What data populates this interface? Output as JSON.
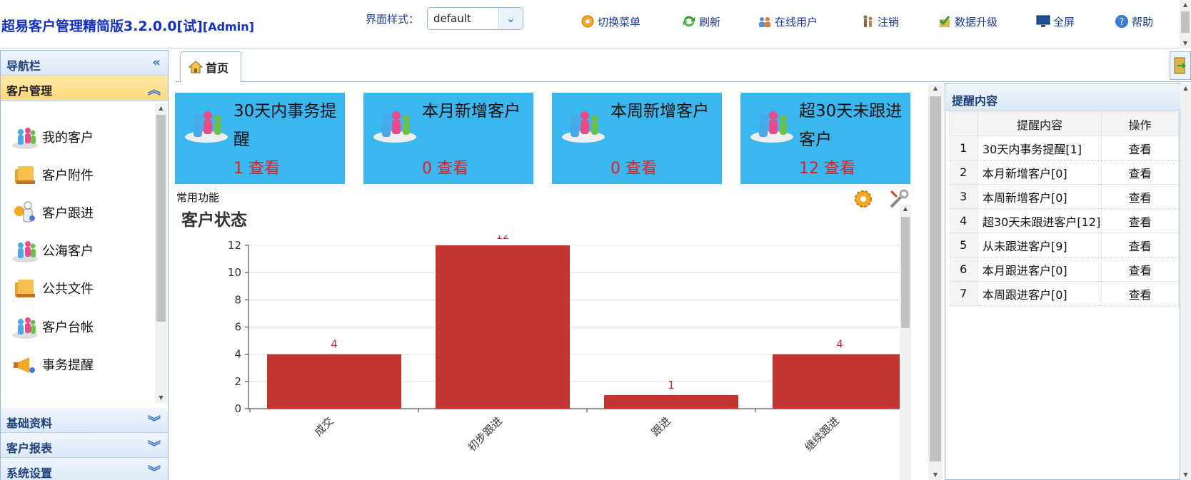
{
  "header": {
    "title": "超易客户管理精简版3.2.0.0[试]",
    "title_admin": "[Admin]",
    "theme_label": "界面样式：",
    "theme_value": "default",
    "toolbar": {
      "switch_menu": "切换菜单",
      "refresh": "刷新",
      "online_users": "在线用户",
      "logout": "注销",
      "upgrade": "数据升级",
      "fullscreen": "全屏",
      "help": "帮助"
    }
  },
  "sidebar": {
    "title": "导航栏",
    "active_group": "客户管理",
    "items": [
      {
        "label": "我的客户",
        "icon": "people-icon"
      },
      {
        "label": "客户附件",
        "icon": "books-icon"
      },
      {
        "label": "客户跟进",
        "icon": "worker-icon"
      },
      {
        "label": "公海客户",
        "icon": "people-icon"
      },
      {
        "label": "公共文件",
        "icon": "books-icon"
      },
      {
        "label": "客户台帐",
        "icon": "people-icon"
      },
      {
        "label": "事务提醒",
        "icon": "megaphone-icon"
      }
    ],
    "groups": [
      "基础资料",
      "客户报表",
      "系统设置"
    ]
  },
  "tabs": {
    "home": "首页"
  },
  "cards": [
    {
      "title": "30天内事务提醒",
      "value": "1 查看"
    },
    {
      "title": "本月新增客户",
      "value": "0 查看"
    },
    {
      "title": "本周新增客户",
      "value": "0 查看"
    },
    {
      "title": "超30天未跟进客户",
      "value": "12 查看"
    }
  ],
  "common_label": "常用功能",
  "chart_data": {
    "type": "bar",
    "title": "客户状态",
    "categories": [
      "成交",
      "初步跟进",
      "跟进",
      "继续跟进"
    ],
    "values": [
      4,
      12,
      1,
      4
    ],
    "ylim": [
      0,
      12
    ],
    "yticks": [
      0,
      2,
      4,
      6,
      8,
      10,
      12
    ],
    "grid": true,
    "bar_color": "#c23531",
    "label_color": "#c23531"
  },
  "reminder": {
    "title": "提醒内容",
    "columns": [
      "提醒内容",
      "操作"
    ],
    "rows": [
      {
        "n": "1",
        "content": "30天内事务提醒[1]",
        "op": "查看"
      },
      {
        "n": "2",
        "content": "本月新增客户[0]",
        "op": "查看"
      },
      {
        "n": "3",
        "content": "本周新增客户[0]",
        "op": "查看"
      },
      {
        "n": "4",
        "content": "超30天未跟进客户[12]",
        "op": "查看"
      },
      {
        "n": "5",
        "content": "从未跟进客户[9]",
        "op": "查看"
      },
      {
        "n": "6",
        "content": "本月跟进客户[0]",
        "op": "查看"
      },
      {
        "n": "7",
        "content": "本周跟进客户[0]",
        "op": "查看"
      }
    ]
  },
  "colors": {
    "card_bg": "#39b7ee",
    "card_value": "#e41c1c",
    "title_blue": "#1030c8",
    "border": "#9ab8de"
  }
}
